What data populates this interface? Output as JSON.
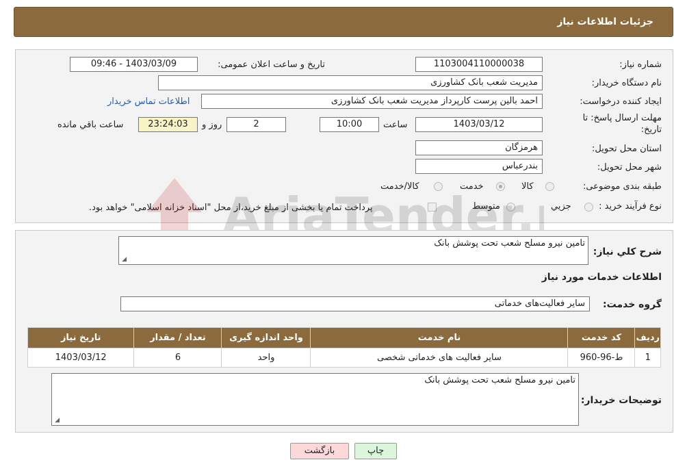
{
  "header": {
    "title": "جزئیات اطلاعات نیاز"
  },
  "form": {
    "need_number": {
      "label": "شماره نیاز:",
      "value": "1103004110000038"
    },
    "announce_datetime": {
      "label": "تاریخ و ساعت اعلان عمومی:",
      "value": "1403/03/09 - 09:46"
    },
    "buyer_org": {
      "label": "نام دستگاه خریدار:",
      "value": "مدیریت شعب بانک کشاورزی"
    },
    "requester": {
      "label": "ایجاد کننده درخواست:",
      "value": "احمد بالین پرست  کارپرداز مدیریت شعب بانک کشاورزی"
    },
    "buyer_contact_link": "اطلاعات تماس خریدار",
    "deadline": {
      "label_line1": "مهلت ارسال پاسخ: تا",
      "label_line2": "تاریخ:",
      "date": "1403/03/12",
      "time_label": "ساعت",
      "time": "10:00",
      "days": "2",
      "days_label": "روز و",
      "remaining": "23:24:03",
      "remaining_label": "ساعت باقي مانده"
    },
    "province": {
      "label": "استان محل تحویل:",
      "value": "هرمزگان"
    },
    "city": {
      "label": "شهر محل تحویل:",
      "value": "بندرعباس"
    },
    "category": {
      "label": "طبقه بندی موضوعی:",
      "options": [
        "کالا",
        "خدمت",
        "کالا/خدمت"
      ],
      "selected": "خدمت"
    },
    "purchase_process": {
      "label": "نوع فرآیند خرید :",
      "options": [
        "جزیي",
        "متوسط"
      ],
      "payment_note": "پرداخت تمام یا بخشی از مبلغ خرید،از محل \"اسناد خزانه اسلامی\" خواهد بود."
    }
  },
  "details": {
    "summary_label": "شرح کلي نياز:",
    "summary_value": "تامین نیرو مسلح شعب تحت پوشش بانک",
    "services_heading": "اطلاعات خدمات مورد نیاز",
    "service_group_label": "گروه خدمت:",
    "service_group_value": "سایر فعالیت‌های خدماتی",
    "table": {
      "headers": [
        "ردیف",
        "کد خدمت",
        "نام خدمت",
        "واحد اندازه گیری",
        "تعداد / مقدار",
        "تاریخ نیاز"
      ],
      "rows": [
        [
          "1",
          "ط-96-960",
          "سایر فعالیت های خدماتی شخصی",
          "واحد",
          "6",
          "1403/03/12"
        ]
      ]
    },
    "buyer_notes_label": "توضیحات خریدار:",
    "buyer_notes_value": "تامین نیرو مسلح شعب تحت پوشش بانک"
  },
  "buttons": {
    "print": "چاپ",
    "back": "بازگشت"
  },
  "watermark": {
    "text": "AriaTender.neT"
  },
  "colors": {
    "header_bg": "#8b6a3e",
    "link": "#1a5fb4",
    "back_btn": "#fcd9d9",
    "print_btn": "#dcf6dc"
  }
}
